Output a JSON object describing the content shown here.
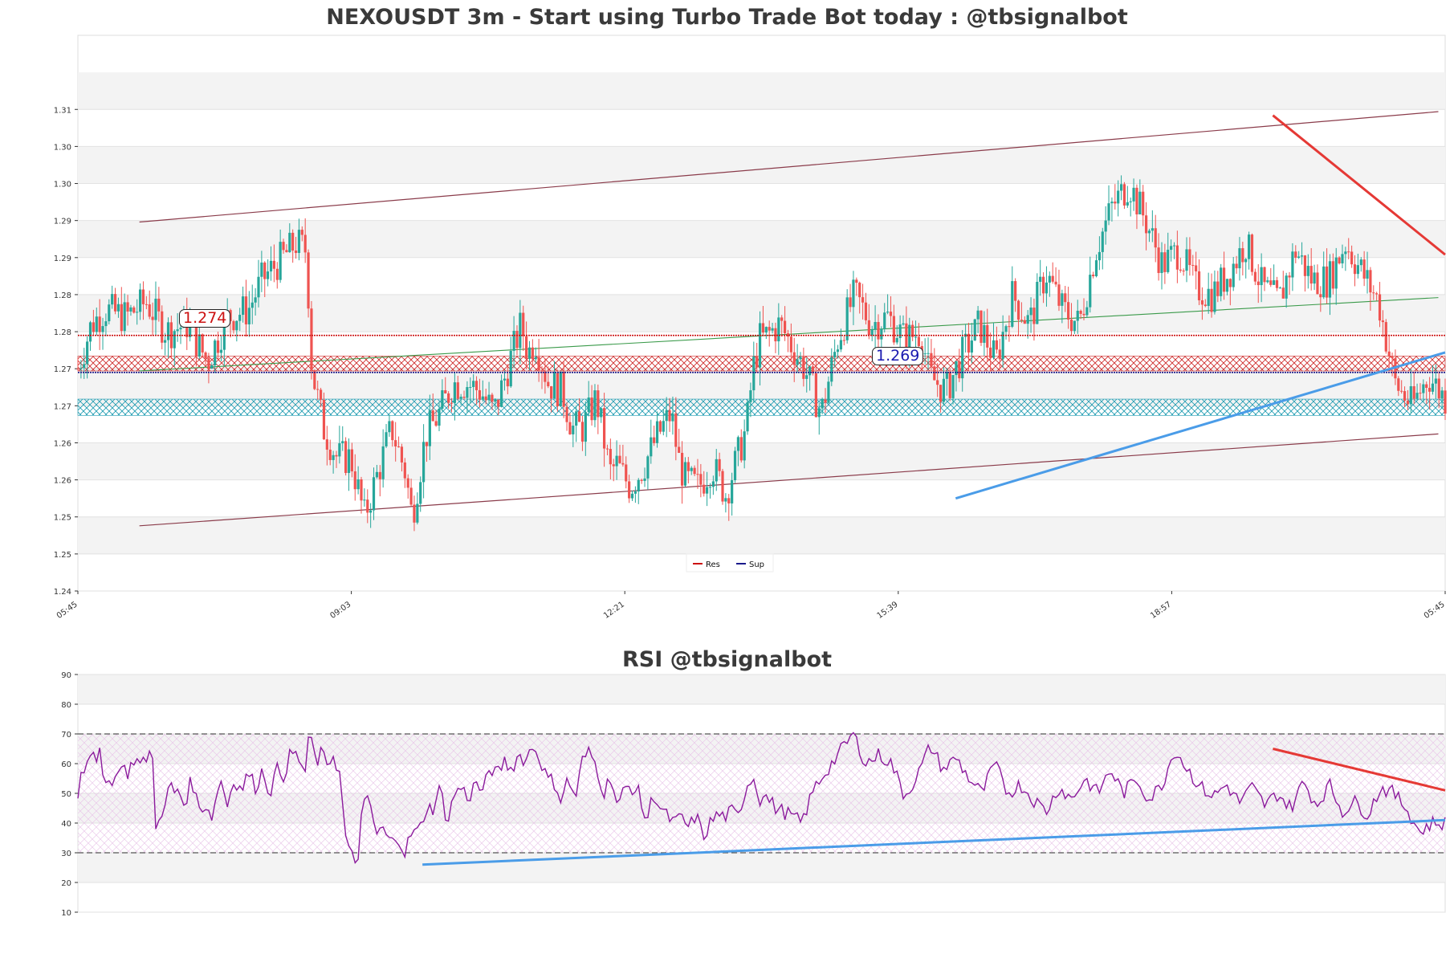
{
  "chart_data": [
    {
      "type": "candlestick",
      "title": "NEXOUSDT 3m - Start using Turbo Trade Bot today : @tbsignalbot",
      "ylim": [
        1.24,
        1.315
      ],
      "y_ticks": [
        "1.24",
        "1.25",
        "1.25",
        "1.26",
        "1.26",
        "1.27",
        "1.27",
        "1.28",
        "1.28",
        "1.29",
        "1.29",
        "1.30",
        "1.30",
        "1.31"
      ],
      "x_ticks": [
        "05:45",
        "09:03",
        "12:21",
        "15:39",
        "18:57",
        "05:45"
      ],
      "legend": {
        "position": "bottom-center",
        "items": [
          {
            "name": "Res",
            "color": "#cc1111"
          },
          {
            "name": "Sup",
            "color": "#1a1a8c"
          }
        ]
      },
      "resistance": {
        "value": 1.2745,
        "label": "1.274",
        "color": "#cc1111"
      },
      "support": {
        "value": 1.2695,
        "label": "1.269",
        "color": "#1a1a8c"
      },
      "resistance_zone": [
        1.2697,
        1.2717
      ],
      "support_zone": [
        1.2637,
        1.2659
      ],
      "channel_upper": [
        [
          0.045,
          1.2898
        ],
        [
          0.995,
          1.3047
        ]
      ],
      "channel_lower": [
        [
          0.045,
          1.2488
        ],
        [
          0.995,
          1.2612
        ]
      ],
      "midline": [
        [
          0.045,
          1.2697
        ],
        [
          0.995,
          1.2796
        ]
      ],
      "trendline_down": [
        [
          0.874,
          1.3042
        ],
        [
          1.0,
          1.2854
        ]
      ],
      "trendline_up": [
        [
          0.642,
          1.2525
        ],
        [
          1.0,
          1.2722
        ]
      ],
      "price_anchors": [
        [
          0,
          1.27
        ],
        [
          0.02,
          1.276
        ],
        [
          0.04,
          1.278
        ],
        [
          0.07,
          1.277
        ],
        [
          0.1,
          1.279
        ],
        [
          0.13,
          1.275
        ],
        [
          0.16,
          1.276
        ],
        [
          0.19,
          1.271
        ],
        [
          0.22,
          1.277
        ],
        [
          0.25,
          1.278
        ],
        [
          0.27,
          1.282
        ],
        [
          0.3,
          1.285
        ],
        [
          0.32,
          1.287
        ],
        [
          0.335,
          1.286
        ],
        [
          0.343,
          1.27
        ],
        [
          0.36,
          1.262
        ],
        [
          0.38,
          1.258
        ],
        [
          0.4,
          1.258
        ],
        [
          0.42,
          1.25
        ],
        [
          0.44,
          1.256
        ],
        [
          0.46,
          1.262
        ],
        [
          0.48,
          1.256
        ],
        [
          0.49,
          1.25
        ],
        [
          0.51,
          1.261
        ],
        [
          0.53,
          1.264
        ],
        [
          0.55,
          1.268
        ],
        [
          0.57,
          1.268
        ],
        [
          0.59,
          1.267
        ],
        [
          0.61,
          1.264
        ],
        [
          0.63,
          1.27
        ],
        [
          0.65,
          1.276
        ],
        [
          0.66,
          1.272
        ],
        [
          0.67,
          1.274
        ],
        [
          0.69,
          1.268
        ],
        [
          0.71,
          1.267
        ],
        [
          0.725,
          1.262
        ],
        [
          0.74,
          1.262
        ],
        [
          0.76,
          1.266
        ],
        [
          0.78,
          1.256
        ],
        [
          0.79,
          1.257
        ],
        [
          0.81,
          1.254
        ],
        [
          0.83,
          1.257
        ],
        [
          0.85,
          1.261
        ],
        [
          0.87,
          1.264
        ],
        [
          0.88,
          1.258
        ],
        [
          0.89,
          1.255
        ],
        [
          0.91,
          1.254
        ],
        [
          0.93,
          1.257
        ],
        [
          0.95,
          1.253
        ],
        [
          0.96,
          1.256
        ],
        [
          0.98,
          1.262
        ],
        [
          0.99,
          1.27
        ],
        [
          1.0,
          1.274
        ]
      ],
      "price_anchors_right": [
        [
          0,
          1.274
        ],
        [
          0.02,
          1.276
        ],
        [
          0.05,
          1.27
        ],
        [
          0.07,
          1.264
        ],
        [
          0.09,
          1.274
        ],
        [
          0.11,
          1.28
        ],
        [
          0.13,
          1.276
        ],
        [
          0.15,
          1.277
        ],
        [
          0.17,
          1.274
        ],
        [
          0.19,
          1.275
        ],
        [
          0.2,
          1.269
        ],
        [
          0.22,
          1.267
        ],
        [
          0.24,
          1.272
        ],
        [
          0.26,
          1.276
        ],
        [
          0.28,
          1.271
        ],
        [
          0.3,
          1.28
        ],
        [
          0.32,
          1.276
        ],
        [
          0.34,
          1.283
        ],
        [
          0.36,
          1.278
        ],
        [
          0.38,
          1.276
        ],
        [
          0.4,
          1.286
        ],
        [
          0.42,
          1.292
        ],
        [
          0.44,
          1.295
        ],
        [
          0.46,
          1.29
        ],
        [
          0.48,
          1.284
        ],
        [
          0.5,
          1.286
        ],
        [
          0.52,
          1.281
        ],
        [
          0.54,
          1.28
        ],
        [
          0.56,
          1.283
        ],
        [
          0.58,
          1.287
        ],
        [
          0.6,
          1.281
        ],
        [
          0.62,
          1.279
        ],
        [
          0.64,
          1.286
        ],
        [
          0.66,
          1.282
        ],
        [
          0.68,
          1.282
        ],
        [
          0.7,
          1.287
        ],
        [
          0.72,
          1.283
        ],
        [
          0.74,
          1.279
        ],
        [
          0.76,
          1.268
        ],
        [
          0.78,
          1.265
        ],
        [
          0.8,
          1.269
        ],
        [
          0.82,
          1.266
        ]
      ]
    },
    {
      "type": "line",
      "title": "RSI @tbsignalbot",
      "ylim": [
        10,
        90
      ],
      "y_ticks": [
        "10",
        "20",
        "30",
        "40",
        "50",
        "60",
        "70",
        "80",
        "90"
      ],
      "overbought": 70,
      "oversold": 30,
      "line_color": "#8b1a9c",
      "trendline_down": [
        [
          0.874,
          65
        ],
        [
          1.0,
          51
        ]
      ],
      "trendline_up": [
        [
          0.252,
          26
        ],
        [
          1.0,
          41
        ]
      ],
      "rsi_anchors": [
        [
          0,
          50
        ],
        [
          0.005,
          60
        ],
        [
          0.01,
          57
        ],
        [
          0.015,
          65
        ],
        [
          0.02,
          64
        ],
        [
          0.025,
          58
        ],
        [
          0.03,
          64
        ],
        [
          0.035,
          56
        ],
        [
          0.045,
          56
        ],
        [
          0.05,
          50
        ],
        [
          0.055,
          60
        ],
        [
          0.07,
          57
        ],
        [
          0.08,
          62
        ],
        [
          0.09,
          59
        ],
        [
          0.1,
          64
        ],
        [
          0.105,
          62
        ],
        [
          0.11,
          38
        ],
        [
          0.115,
          44
        ],
        [
          0.12,
          40
        ],
        [
          0.13,
          56
        ],
        [
          0.135,
          48
        ],
        [
          0.14,
          52
        ],
        [
          0.15,
          46
        ],
        [
          0.16,
          55
        ],
        [
          0.17,
          45
        ],
        [
          0.18,
          46
        ],
        [
          0.19,
          42
        ],
        [
          0.2,
          56
        ],
        [
          0.21,
          46
        ],
        [
          0.22,
          55
        ],
        [
          0.23,
          51
        ],
        [
          0.24,
          57
        ],
        [
          0.25,
          52
        ],
        [
          0.26,
          58
        ],
        [
          0.27,
          50
        ],
        [
          0.28,
          58
        ],
        [
          0.29,
          56
        ],
        [
          0.3,
          64
        ],
        [
          0.31,
          62
        ],
        [
          0.32,
          57
        ],
        [
          0.325,
          68
        ],
        [
          0.33,
          69
        ],
        [
          0.335,
          58
        ],
        [
          0.34,
          64
        ],
        [
          0.35,
          60
        ],
        [
          0.36,
          63
        ],
        [
          0.37,
          55
        ],
        [
          0.375,
          38
        ],
        [
          0.38,
          31
        ],
        [
          0.385,
          29
        ],
        [
          0.39,
          27
        ],
        [
          0.395,
          30
        ],
        [
          0.4,
          45
        ],
        [
          0.41,
          48
        ],
        [
          0.42,
          36
        ],
        [
          0.43,
          38
        ],
        [
          0.44,
          33
        ],
        [
          0.45,
          36
        ],
        [
          0.46,
          30
        ],
        [
          0.47,
          37
        ],
        [
          0.48,
          37
        ],
        [
          0.49,
          45
        ],
        [
          0.5,
          45
        ],
        [
          0.51,
          52
        ],
        [
          0.52,
          40
        ],
        [
          0.53,
          50
        ],
        [
          0.54,
          52
        ],
        [
          0.55,
          48
        ],
        [
          0.56,
          54
        ],
        [
          0.57,
          50
        ],
        [
          0.58,
          59
        ],
        [
          0.59,
          56
        ],
        [
          0.6,
          61
        ],
        [
          0.61,
          58
        ],
        [
          0.62,
          63
        ],
        [
          0.63,
          61
        ],
        [
          0.64,
          66
        ],
        [
          0.65,
          62
        ],
        [
          0.66,
          55
        ],
        [
          0.67,
          54
        ],
        [
          0.68,
          48
        ],
        [
          0.69,
          55
        ],
        [
          0.7,
          48
        ],
        [
          0.71,
          61
        ],
        [
          0.72,
          64
        ],
        [
          0.73,
          59
        ],
        [
          0.74,
          50
        ],
        [
          0.75,
          56
        ],
        [
          0.76,
          45
        ],
        [
          0.77,
          52
        ],
        [
          0.78,
          52
        ],
        [
          0.79,
          50
        ],
        [
          0.8,
          40
        ],
        [
          0.81,
          50
        ],
        [
          0.82,
          45
        ],
        [
          0.83,
          42
        ],
        [
          0.84,
          40
        ],
        [
          0.85,
          42
        ],
        [
          0.86,
          38
        ],
        [
          0.87,
          43
        ],
        [
          0.88,
          35
        ],
        [
          0.89,
          40
        ],
        [
          0.9,
          43
        ],
        [
          0.91,
          42
        ],
        [
          0.92,
          44
        ],
        [
          0.93,
          42
        ],
        [
          0.94,
          52
        ],
        [
          0.95,
          56
        ],
        [
          0.96,
          48
        ]
      ],
      "rsi_anchors_right": [
        [
          0,
          50
        ],
        [
          0.01,
          45
        ],
        [
          0.02,
          43
        ],
        [
          0.03,
          40
        ],
        [
          0.04,
          52
        ],
        [
          0.05,
          58
        ],
        [
          0.06,
          64
        ],
        [
          0.07,
          70
        ],
        [
          0.08,
          60
        ],
        [
          0.09,
          63
        ],
        [
          0.1,
          60
        ],
        [
          0.11,
          49
        ],
        [
          0.12,
          56
        ],
        [
          0.13,
          66
        ],
        [
          0.14,
          58
        ],
        [
          0.15,
          62
        ],
        [
          0.16,
          55
        ],
        [
          0.17,
          50
        ],
        [
          0.18,
          60
        ],
        [
          0.19,
          50
        ],
        [
          0.2,
          53
        ],
        [
          0.21,
          48
        ],
        [
          0.22,
          44
        ],
        [
          0.23,
          52
        ],
        [
          0.24,
          48
        ],
        [
          0.25,
          55
        ],
        [
          0.26,
          50
        ],
        [
          0.27,
          58
        ],
        [
          0.28,
          50
        ],
        [
          0.29,
          55
        ],
        [
          0.3,
          48
        ],
        [
          0.31,
          53
        ],
        [
          0.32,
          65
        ],
        [
          0.33,
          58
        ],
        [
          0.34,
          52
        ],
        [
          0.35,
          49
        ],
        [
          0.36,
          53
        ],
        [
          0.37,
          47
        ],
        [
          0.38,
          52
        ],
        [
          0.39,
          46
        ],
        [
          0.4,
          50
        ],
        [
          0.41,
          45
        ],
        [
          0.42,
          54
        ],
        [
          0.43,
          46
        ],
        [
          0.44,
          53
        ],
        [
          0.45,
          44
        ],
        [
          0.46,
          47
        ],
        [
          0.47,
          43
        ],
        [
          0.48,
          52
        ],
        [
          0.49,
          50
        ],
        [
          0.5,
          45
        ],
        [
          0.51,
          37
        ],
        [
          0.52,
          40
        ],
        [
          0.53,
          40
        ]
      ]
    }
  ]
}
